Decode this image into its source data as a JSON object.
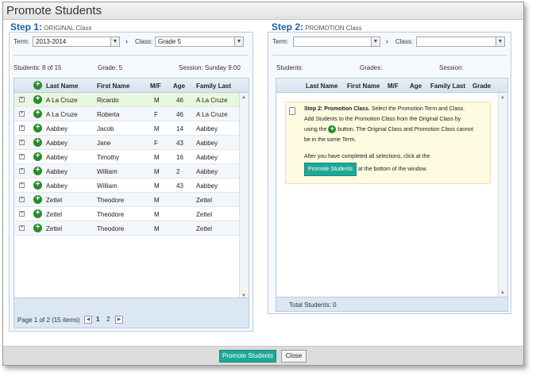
{
  "dialog": {
    "title": "Promote Students",
    "promote_label": "Promote Students",
    "close_label": "Close"
  },
  "step1": {
    "heading": "Step 1:",
    "subheading": "ORIGINAL Class",
    "term_label": "Term:",
    "term_value": "2013-2014",
    "class_label": "Class:",
    "class_value": "Grade 5",
    "students_info": "Students: 8 of 15",
    "grade_info": "Grade: 5",
    "session_info": "Session: Sunday 9:00",
    "columns": [
      "Last Name",
      "First Name",
      "M/F",
      "Age",
      "Family Last"
    ],
    "rows": [
      {
        "last": "A La Cruze",
        "first": "Ricardo",
        "mf": "M",
        "age": "46",
        "family": "A La Cruze"
      },
      {
        "last": "A La Cruze",
        "first": "Roberta",
        "mf": "F",
        "age": "46",
        "family": "A La Cruze"
      },
      {
        "last": "Aabbey",
        "first": "Jacob",
        "mf": "M",
        "age": "14",
        "family": "Aabbey"
      },
      {
        "last": "Aabbey",
        "first": "Jane",
        "mf": "F",
        "age": "43",
        "family": "Aabbey"
      },
      {
        "last": "Aabbey",
        "first": "Timothy",
        "mf": "M",
        "age": "16",
        "family": "Aabbey"
      },
      {
        "last": "Aabbey",
        "first": "William",
        "mf": "M",
        "age": "2",
        "family": "Aabbey"
      },
      {
        "last": "Aabbey",
        "first": "William",
        "mf": "M",
        "age": "43",
        "family": "Aabbey"
      },
      {
        "last": "Zettel",
        "first": "Theodore",
        "mf": "M",
        "age": "",
        "family": "Zettel"
      },
      {
        "last": "Zettel",
        "first": "Theodore",
        "mf": "M",
        "age": "",
        "family": "Zettel"
      },
      {
        "last": "Zettel",
        "first": "Theodore",
        "mf": "M",
        "age": "",
        "family": "Zettel"
      }
    ],
    "pager_text": "Page 1 of 2 (15 items)",
    "page1": "1",
    "page2": "2"
  },
  "step2": {
    "heading": "Step 2:",
    "subheading": "PROMOTION Class",
    "term_label": "Term:",
    "term_value": "",
    "class_label": "Class:",
    "class_value": "",
    "students_info": "Students:",
    "grade_info": "Grades:",
    "session_info": "Session:",
    "columns": [
      "Last Name",
      "First Name",
      "M/F",
      "Age",
      "Family Last",
      "Grade"
    ],
    "info_title": "Step 2: Promotion Class.",
    "info_line1_rest": "Select the Promotion Term and Class.",
    "info_line2": "Add Students to the Promotion Class from the Original Class by",
    "info_line3_pre": "using the",
    "info_line3_post": "button. The Original Class and Promotion Class cannot",
    "info_line4": "be in the same Term.",
    "info_line5": "After you have completed all selections, click at the",
    "info_button": "Promote Students",
    "info_line6_post": "at the bottom of the window.",
    "total_students": "Total Students: 0"
  },
  "colors": {
    "accent_teal": "#1fa898",
    "heading_blue": "#1a5fa8",
    "add_green": "#2b8a2b"
  }
}
